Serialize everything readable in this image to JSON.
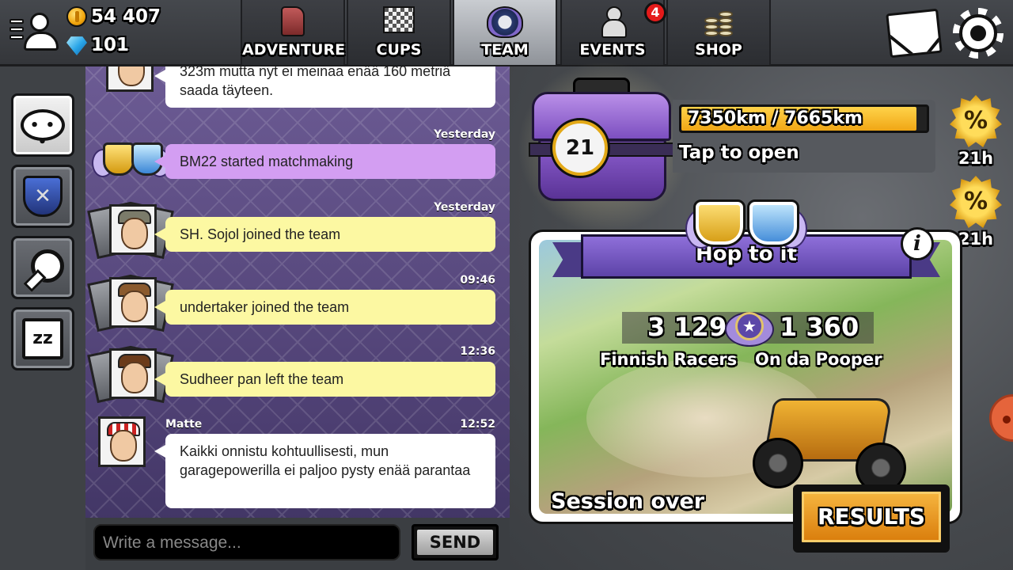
{
  "currency": {
    "coins": "54 407",
    "gems": "101"
  },
  "tabs": [
    {
      "label": "ADVENTURE",
      "icon": "fuel-canister-icon"
    },
    {
      "label": "CUPS",
      "icon": "checkered-flags-icon"
    },
    {
      "label": "TEAM",
      "icon": "team-emblem-icon",
      "active": true
    },
    {
      "label": "EVENTS",
      "icon": "events-people-icon",
      "badge": "4"
    },
    {
      "label": "SHOP",
      "icon": "coin-stacks-icon"
    }
  ],
  "header_icons": [
    "profile-menu-icon",
    "mail-icon",
    "gear-icon"
  ],
  "side_buttons": [
    "chat-bubble-icon",
    "team-shield-icon",
    "magnifier-icon",
    "sleep-zz-icon"
  ],
  "chat": {
    "messages": [
      {
        "type": "text",
        "text": "323m mutta nyt ei meinaa enää 160 metriä saada täyteen.",
        "color": "white"
      },
      {
        "type": "system",
        "time": "Yesterday",
        "text": "BM22 started matchmaking",
        "color": "purple"
      },
      {
        "type": "system",
        "time": "Yesterday",
        "text": "SH.  Sojol joined the team",
        "color": "yellow"
      },
      {
        "type": "system",
        "time": "09:46",
        "text": "undertaker joined the team",
        "color": "yellow"
      },
      {
        "type": "system",
        "time": "12:36",
        "text": "Sudheer pan left the team",
        "color": "yellow"
      },
      {
        "type": "text",
        "author": "Matte",
        "time": "12:52",
        "text": "Kaikki onnistu kohtuullisesti, mun garagepowerilla ei paljoo pysty enää parantaa",
        "color": "white"
      }
    ],
    "input_placeholder": "Write a message...",
    "send_label": "SEND"
  },
  "chest": {
    "level": "21",
    "progress_text": "7350km / 7665km",
    "progress_fraction": 0.959,
    "tap_label": "Tap to open"
  },
  "boosts": [
    {
      "symbol": "%",
      "time": "21h"
    },
    {
      "symbol": "%",
      "time": "21h"
    }
  ],
  "event": {
    "title": "Hop to it",
    "info_symbol": "i",
    "score_left": "3 129",
    "score_right": "1 360",
    "medal_symbol": "★",
    "team_left": "Finnish Racers",
    "team_right": "On da Pooper",
    "status": "Session over",
    "results_label": "RESULTS"
  },
  "colors": {
    "chat_bg": "#5a4a82",
    "bubble_yellow": "#fcf8a2",
    "bubble_purple": "#d39ef2",
    "bubble_white": "#ffffff",
    "progress_fill": "#f0a615",
    "results_button": "#e38b15"
  }
}
